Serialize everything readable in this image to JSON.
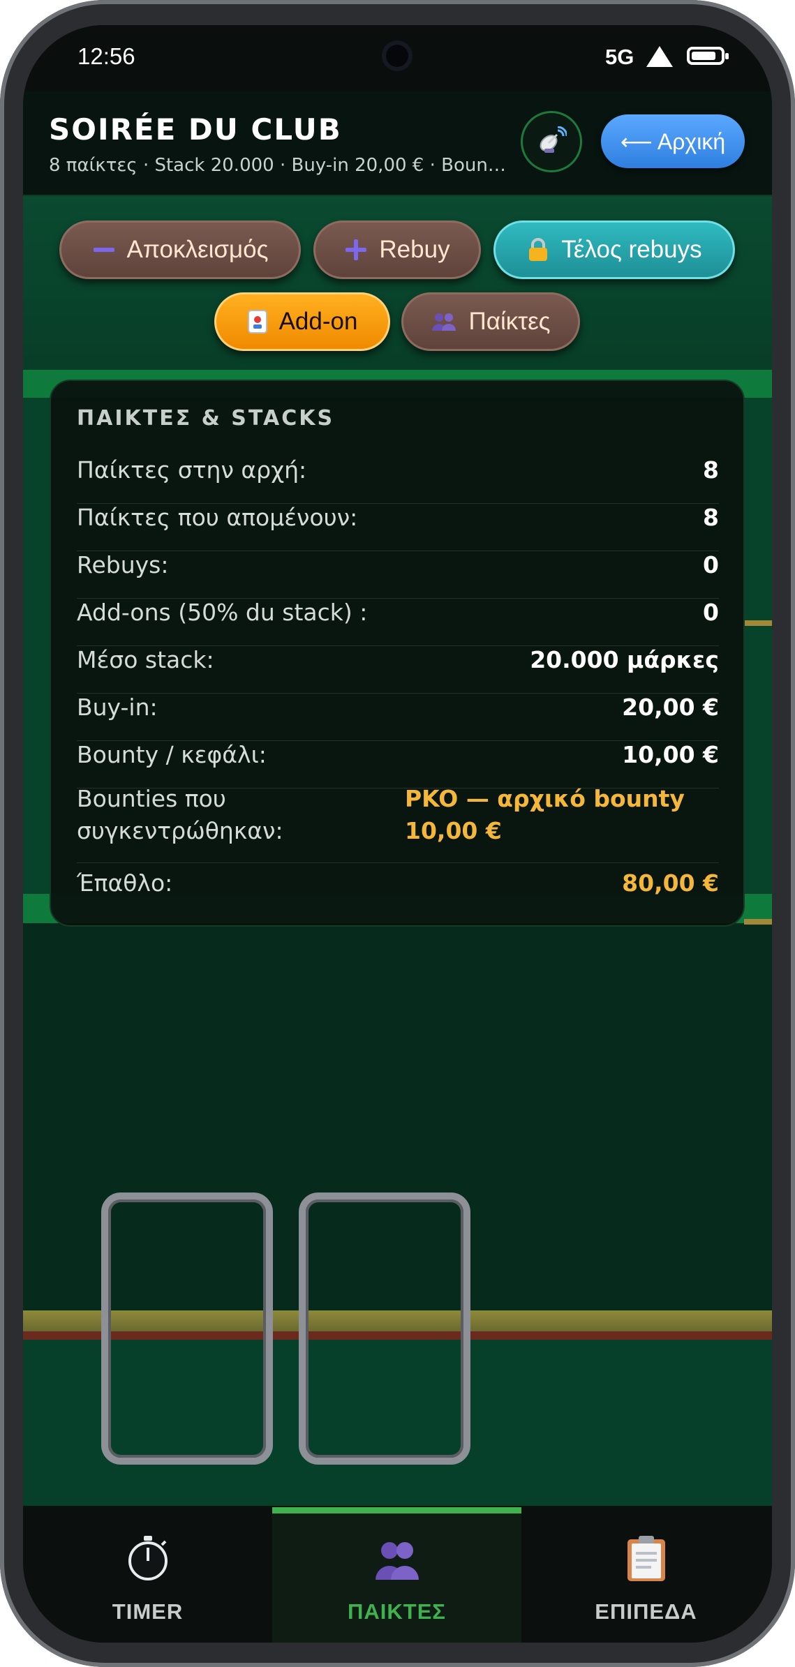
{
  "status_bar": {
    "time": "12:56",
    "network": "5G"
  },
  "header": {
    "title": "SOIRÉE DU CLUB",
    "subtitle": "8 παίκτες · Stack 20.000 · Buy-in 20,00 € · Bounty …",
    "cast_icon": "satellite-antenna-icon",
    "home_label": "⟵ Αρχική"
  },
  "actions": {
    "eliminate": "Αποκλεισμός",
    "rebuy": "Rebuy",
    "end_rebuys": "Τέλος rebuys",
    "addon": "Add-on",
    "players": "Παίκτες"
  },
  "stats": {
    "title": "ΠΑΙΚΤΕΣ & STACKS",
    "rows": [
      {
        "label": "Παίκτες στην αρχή:",
        "value": "8"
      },
      {
        "label": "Παίκτες που απομένουν:",
        "value": "8"
      },
      {
        "label": "Rebuys:",
        "value": "0"
      },
      {
        "label": "Add-ons (50% du stack) :",
        "value": "0"
      },
      {
        "label": "Μέσο stack:",
        "value": "20.000 μάρκες"
      },
      {
        "label": "Buy-in:",
        "value": "20,00 €"
      },
      {
        "label": "Bounty / κεφάλι:",
        "value": "10,00 €"
      },
      {
        "label": "Bounties που συγκεντρώθηκαν:",
        "value": "PKO — αρχικό bounty 10,00 €"
      },
      {
        "label": "Έπαθλο:",
        "value": "80,00 €"
      }
    ]
  },
  "nav": {
    "tabs": [
      {
        "label": "TIMER",
        "icon": "stopwatch-icon"
      },
      {
        "label": "ΠΑΙΚΤΕΣ",
        "icon": "players-icon",
        "active": true
      },
      {
        "label": "ΕΠΙΠΕΔΑ",
        "icon": "clipboard-icon"
      }
    ]
  },
  "colors": {
    "accent": "#3fb24f",
    "home_button": "#3d8ef0",
    "addon": "#f59a0a",
    "gold_text": "#f4b73a"
  }
}
